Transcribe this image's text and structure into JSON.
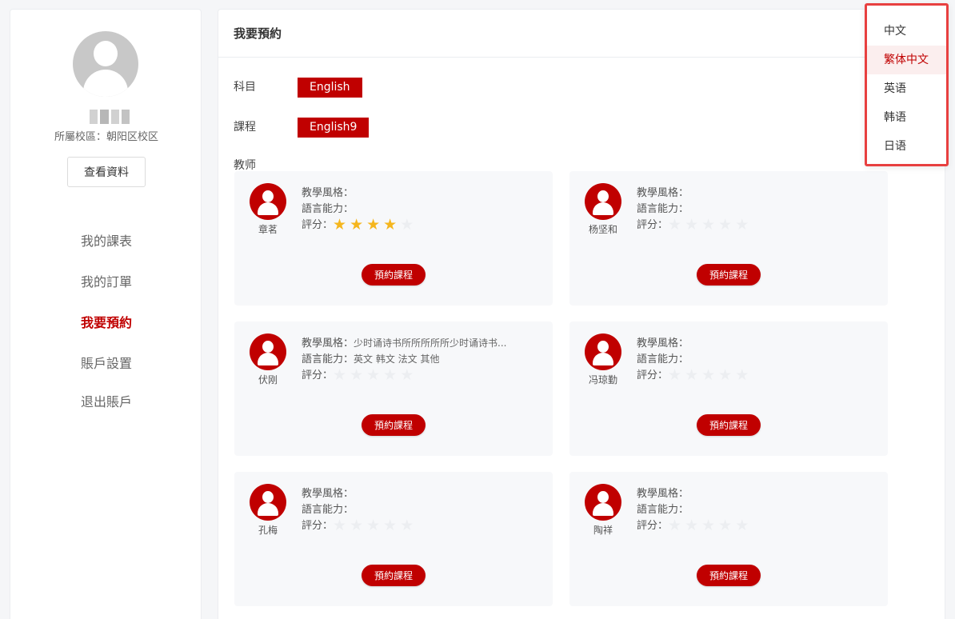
{
  "sidebar": {
    "campus": "所屬校區：朝阳区校区",
    "view_profile": "查看資料",
    "nav": [
      "我的課表",
      "我的訂單",
      "我要預約",
      "賬戶設置",
      "退出賬戶"
    ]
  },
  "main": {
    "title": "我要預約",
    "subject_label": "科目",
    "subject_value": "English",
    "course_label": "課程",
    "course_value": "English9",
    "teacher_label": "教师",
    "style_label": "教學風格：",
    "lang_label": "語言能力：",
    "rating_label": "評分：",
    "book_label": "預約課程",
    "teachers": [
      {
        "name": "章茗",
        "style": "",
        "languages": "",
        "rating": 4
      },
      {
        "name": "杨坚和",
        "style": "",
        "languages": "",
        "rating": 0
      },
      {
        "name": "伏刚",
        "style": "少时诵诗书所所所所所少时诵诗书...",
        "languages": "英文 韩文 法文 其他",
        "rating": 0
      },
      {
        "name": "冯琼勤",
        "style": "",
        "languages": "",
        "rating": 0
      },
      {
        "name": "孔梅",
        "style": "",
        "languages": "",
        "rating": 0
      },
      {
        "name": "陶祥",
        "style": "",
        "languages": "",
        "rating": 0
      }
    ]
  },
  "language_menu": {
    "items": [
      "中文",
      "繁体中文",
      "英语",
      "韩语",
      "日语"
    ],
    "selected": "繁体中文"
  },
  "colors": {
    "accent": "#c00000",
    "star": "#f5b61e",
    "highlight_border": "#e84040"
  }
}
